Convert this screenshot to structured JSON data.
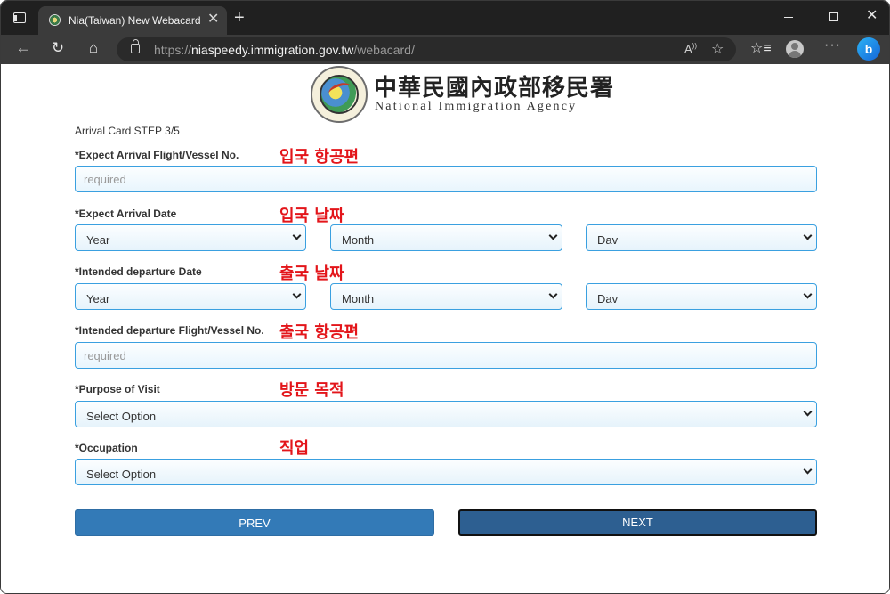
{
  "browser": {
    "tab_title": "Nia(Taiwan) New Webacard",
    "tab_close": "✕",
    "new_tab": "+",
    "url_prefix": "https://",
    "url_host": "niaspeedy.immigration.gov.tw",
    "url_path": "/webacard/",
    "icons": [
      "tab-actions-icon",
      "favicon-icon",
      "back-icon",
      "refresh-icon",
      "home-icon",
      "lock-icon",
      "read-aloud-icon",
      "favorite-add-icon",
      "collections-icon",
      "profile-icon",
      "more-icon",
      "bing-icon"
    ]
  },
  "header": {
    "agency_cn": "中華民國內政部移民署",
    "agency_en": "National Immigration Agency"
  },
  "form": {
    "step": "Arrival Card STEP 3/5",
    "arrival_flight": {
      "label": "*Expect Arrival Flight/Vessel No.",
      "note": "입국 항공편",
      "placeholder": "required"
    },
    "arrival_date": {
      "label": "*Expect Arrival Date",
      "note": "입국 날짜",
      "year": "Year",
      "month": "Month",
      "day": "Dav"
    },
    "departure_date": {
      "label": "*Intended departure Date",
      "note": "출국 날짜",
      "year": "Year",
      "month": "Month",
      "day": "Dav"
    },
    "departure_flight": {
      "label": "*Intended departure Flight/Vessel No.",
      "note": "출국 항공편",
      "placeholder": "required"
    },
    "purpose": {
      "label": "*Purpose of Visit",
      "note": "방문 목적",
      "value": "Select Option"
    },
    "occupation": {
      "label": "*Occupation",
      "note": "직업",
      "value": "Select Option"
    },
    "prev_label": "PREV",
    "next_label": "NEXT"
  },
  "colors": {
    "accent": "#337ab7",
    "next_button": "#2d5f91",
    "annotation": "#e3151a",
    "input_border": "#3aa0e0"
  }
}
